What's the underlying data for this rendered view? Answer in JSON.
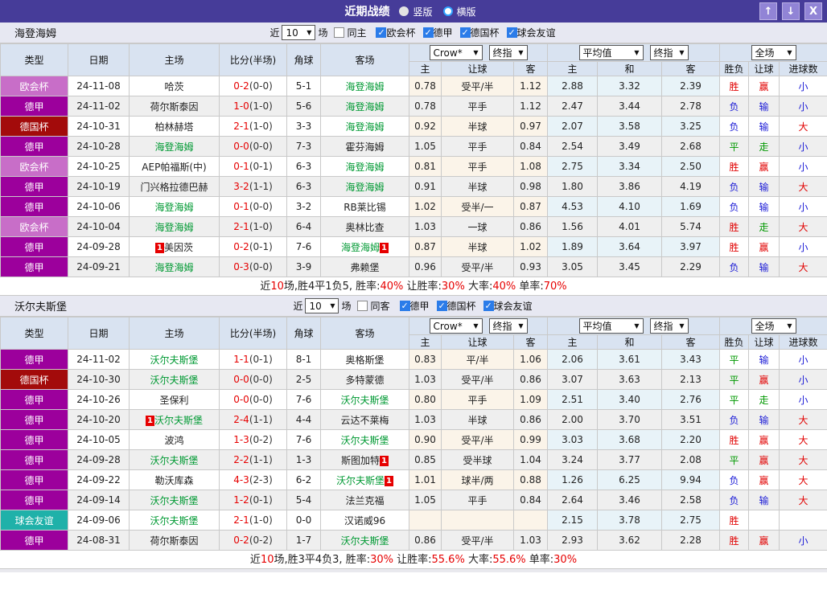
{
  "titlebar": {
    "title": "近期战绩",
    "radios": [
      {
        "label": "竖版",
        "selected": true
      },
      {
        "label": "横版",
        "selected": false
      }
    ]
  },
  "icons": {
    "up_arrow": "↑",
    "down_arrow": "↓",
    "close": "X",
    "chevron_down": "▼"
  },
  "filter_labels": {
    "near": "近",
    "games": "场"
  },
  "dropdowns": {
    "source": "Crow*",
    "final1": "终指",
    "avg": "平均值",
    "final2": "终指",
    "scope": "全场"
  },
  "columns": {
    "type": "类型",
    "date": "日期",
    "home": "主场",
    "score": "比分(半场)",
    "corner": "角球",
    "away": "客场",
    "sub_home": "主",
    "sub_handicap": "让球",
    "sub_away": "客",
    "sub_avg_home": "主",
    "sub_avg_draw": "和",
    "sub_avg_away": "客",
    "sub_result": "胜负",
    "sub_handicap_result": "让球",
    "sub_goals": "进球数"
  },
  "league_colors": {
    "欧会杯": "#c86ec8",
    "德甲": "#9c009c",
    "德国杯": "#a30b0b",
    "球会友谊": "#1fb1a9"
  },
  "value_colors": {
    "胜": "#e10000",
    "赢": "#e10000",
    "大": "#e10000",
    "负": "#1a1ad6",
    "输": "#1a1ad6",
    "小": "#1a1ad6",
    "平": "#009900",
    "走": "#009900"
  },
  "sections": [
    {
      "team": "海登海姆",
      "near_value": "10",
      "same_label": "同主",
      "same_checked": false,
      "leagues": [
        {
          "label": "欧会杯",
          "checked": true
        },
        {
          "label": "德甲",
          "checked": true
        },
        {
          "label": "德国杯",
          "checked": true
        },
        {
          "label": "球会友谊",
          "checked": true
        }
      ],
      "rows": [
        {
          "type": "欧会杯",
          "date": "24-11-08",
          "home": "哈茨",
          "home_is_subject": false,
          "home_badge": "",
          "score_full": "0-2",
          "score_half": "(0-0)",
          "corner": "5-1",
          "away": "海登海姆",
          "away_is_subject": true,
          "away_badge": "",
          "odds_home": "0.78",
          "handicap": "受平/半",
          "odds_away": "1.12",
          "avg_home": "2.88",
          "avg_draw": "3.32",
          "avg_away": "2.39",
          "result": "胜",
          "handicap_result": "赢",
          "goals": "小"
        },
        {
          "type": "德甲",
          "date": "24-11-02",
          "home": "荷尔斯泰因",
          "home_is_subject": false,
          "home_badge": "",
          "score_full": "1-0",
          "score_half": "(1-0)",
          "corner": "5-6",
          "away": "海登海姆",
          "away_is_subject": true,
          "away_badge": "",
          "odds_home": "0.78",
          "handicap": "平手",
          "odds_away": "1.12",
          "avg_home": "2.47",
          "avg_draw": "3.44",
          "avg_away": "2.78",
          "result": "负",
          "handicap_result": "输",
          "goals": "小"
        },
        {
          "type": "德国杯",
          "date": "24-10-31",
          "home": "柏林赫塔",
          "home_is_subject": false,
          "home_badge": "",
          "score_full": "2-1",
          "score_half": "(1-0)",
          "corner": "3-3",
          "away": "海登海姆",
          "away_is_subject": true,
          "away_badge": "",
          "odds_home": "0.92",
          "handicap": "半球",
          "odds_away": "0.97",
          "avg_home": "2.07",
          "avg_draw": "3.58",
          "avg_away": "3.25",
          "result": "负",
          "handicap_result": "输",
          "goals": "大"
        },
        {
          "type": "德甲",
          "date": "24-10-28",
          "home": "海登海姆",
          "home_is_subject": true,
          "home_badge": "",
          "score_full": "0-0",
          "score_half": "(0-0)",
          "corner": "7-3",
          "away": "霍芬海姆",
          "away_is_subject": false,
          "away_badge": "",
          "odds_home": "1.05",
          "handicap": "平手",
          "odds_away": "0.84",
          "avg_home": "2.54",
          "avg_draw": "3.49",
          "avg_away": "2.68",
          "result": "平",
          "handicap_result": "走",
          "goals": "小"
        },
        {
          "type": "欧会杯",
          "date": "24-10-25",
          "home": "AEP帕福斯(中)",
          "home_is_subject": false,
          "home_badge": "",
          "score_full": "0-1",
          "score_half": "(0-1)",
          "corner": "6-3",
          "away": "海登海姆",
          "away_is_subject": true,
          "away_badge": "",
          "odds_home": "0.81",
          "handicap": "平手",
          "odds_away": "1.08",
          "avg_home": "2.75",
          "avg_draw": "3.34",
          "avg_away": "2.50",
          "result": "胜",
          "handicap_result": "赢",
          "goals": "小"
        },
        {
          "type": "德甲",
          "date": "24-10-19",
          "home": "门兴格拉德巴赫",
          "home_is_subject": false,
          "home_badge": "",
          "score_full": "3-2",
          "score_half": "(1-1)",
          "corner": "6-3",
          "away": "海登海姆",
          "away_is_subject": true,
          "away_badge": "",
          "odds_home": "0.91",
          "handicap": "半球",
          "odds_away": "0.98",
          "avg_home": "1.80",
          "avg_draw": "3.86",
          "avg_away": "4.19",
          "result": "负",
          "handicap_result": "输",
          "goals": "大"
        },
        {
          "type": "德甲",
          "date": "24-10-06",
          "home": "海登海姆",
          "home_is_subject": true,
          "home_badge": "",
          "score_full": "0-1",
          "score_half": "(0-0)",
          "corner": "3-2",
          "away": "RB莱比锡",
          "away_is_subject": false,
          "away_badge": "",
          "odds_home": "1.02",
          "handicap": "受半/一",
          "odds_away": "0.87",
          "avg_home": "4.53",
          "avg_draw": "4.10",
          "avg_away": "1.69",
          "result": "负",
          "handicap_result": "输",
          "goals": "小"
        },
        {
          "type": "欧会杯",
          "date": "24-10-04",
          "home": "海登海姆",
          "home_is_subject": true,
          "home_badge": "",
          "score_full": "2-1",
          "score_half": "(1-0)",
          "corner": "6-4",
          "away": "奥林比查",
          "away_is_subject": false,
          "away_badge": "",
          "odds_home": "1.03",
          "handicap": "一球",
          "odds_away": "0.86",
          "avg_home": "1.56",
          "avg_draw": "4.01",
          "avg_away": "5.74",
          "result": "胜",
          "handicap_result": "走",
          "goals": "大"
        },
        {
          "type": "德甲",
          "date": "24-09-28",
          "home": "美因茨",
          "home_is_subject": false,
          "home_badge": "1",
          "score_full": "0-2",
          "score_half": "(0-1)",
          "corner": "7-6",
          "away": "海登海姆",
          "away_is_subject": true,
          "away_badge": "1",
          "odds_home": "0.87",
          "handicap": "半球",
          "odds_away": "1.02",
          "avg_home": "1.89",
          "avg_draw": "3.64",
          "avg_away": "3.97",
          "result": "胜",
          "handicap_result": "赢",
          "goals": "小"
        },
        {
          "type": "德甲",
          "date": "24-09-21",
          "home": "海登海姆",
          "home_is_subject": true,
          "home_badge": "",
          "score_full": "0-3",
          "score_half": "(0-0)",
          "corner": "3-9",
          "away": "弗赖堡",
          "away_is_subject": false,
          "away_badge": "",
          "odds_home": "0.96",
          "handicap": "受平/半",
          "odds_away": "0.93",
          "avg_home": "3.05",
          "avg_draw": "3.45",
          "avg_away": "2.29",
          "result": "负",
          "handicap_result": "输",
          "goals": "大"
        }
      ],
      "summary": [
        {
          "t": "近",
          "red": false
        },
        {
          "t": "10",
          "red": true
        },
        {
          "t": "场,胜4平1负5, 胜率:",
          "red": false
        },
        {
          "t": "40%",
          "red": true
        },
        {
          "t": " 让胜率:",
          "red": false
        },
        {
          "t": "30%",
          "red": true
        },
        {
          "t": " 大率:",
          "red": false
        },
        {
          "t": "40%",
          "red": true
        },
        {
          "t": " 单率:",
          "red": false
        },
        {
          "t": "70%",
          "red": true
        }
      ]
    },
    {
      "team": "沃尔夫斯堡",
      "near_value": "10",
      "same_label": "同客",
      "same_checked": false,
      "leagues": [
        {
          "label": "德甲",
          "checked": true
        },
        {
          "label": "德国杯",
          "checked": true
        },
        {
          "label": "球会友谊",
          "checked": true
        }
      ],
      "rows": [
        {
          "type": "德甲",
          "date": "24-11-02",
          "home": "沃尔夫斯堡",
          "home_is_subject": true,
          "home_badge": "",
          "score_full": "1-1",
          "score_half": "(0-1)",
          "corner": "8-1",
          "away": "奥格斯堡",
          "away_is_subject": false,
          "away_badge": "",
          "odds_home": "0.83",
          "handicap": "平/半",
          "odds_away": "1.06",
          "avg_home": "2.06",
          "avg_draw": "3.61",
          "avg_away": "3.43",
          "result": "平",
          "handicap_result": "输",
          "goals": "小"
        },
        {
          "type": "德国杯",
          "date": "24-10-30",
          "home": "沃尔夫斯堡",
          "home_is_subject": true,
          "home_badge": "",
          "score_full": "0-0",
          "score_half": "(0-0)",
          "corner": "2-5",
          "away": "多特蒙德",
          "away_is_subject": false,
          "away_badge": "",
          "odds_home": "1.03",
          "handicap": "受平/半",
          "odds_away": "0.86",
          "avg_home": "3.07",
          "avg_draw": "3.63",
          "avg_away": "2.13",
          "result": "平",
          "handicap_result": "赢",
          "goals": "小"
        },
        {
          "type": "德甲",
          "date": "24-10-26",
          "home": "圣保利",
          "home_is_subject": false,
          "home_badge": "",
          "score_full": "0-0",
          "score_half": "(0-0)",
          "corner": "7-6",
          "away": "沃尔夫斯堡",
          "away_is_subject": true,
          "away_badge": "",
          "odds_home": "0.80",
          "handicap": "平手",
          "odds_away": "1.09",
          "avg_home": "2.51",
          "avg_draw": "3.40",
          "avg_away": "2.76",
          "result": "平",
          "handicap_result": "走",
          "goals": "小"
        },
        {
          "type": "德甲",
          "date": "24-10-20",
          "home": "沃尔夫斯堡",
          "home_is_subject": true,
          "home_badge": "1",
          "score_full": "2-4",
          "score_half": "(1-1)",
          "corner": "4-4",
          "away": "云达不莱梅",
          "away_is_subject": false,
          "away_badge": "",
          "odds_home": "1.03",
          "handicap": "半球",
          "odds_away": "0.86",
          "avg_home": "2.00",
          "avg_draw": "3.70",
          "avg_away": "3.51",
          "result": "负",
          "handicap_result": "输",
          "goals": "大"
        },
        {
          "type": "德甲",
          "date": "24-10-05",
          "home": "波鸿",
          "home_is_subject": false,
          "home_badge": "",
          "score_full": "1-3",
          "score_half": "(0-2)",
          "corner": "7-6",
          "away": "沃尔夫斯堡",
          "away_is_subject": true,
          "away_badge": "",
          "odds_home": "0.90",
          "handicap": "受平/半",
          "odds_away": "0.99",
          "avg_home": "3.03",
          "avg_draw": "3.68",
          "avg_away": "2.20",
          "result": "胜",
          "handicap_result": "赢",
          "goals": "大"
        },
        {
          "type": "德甲",
          "date": "24-09-28",
          "home": "沃尔夫斯堡",
          "home_is_subject": true,
          "home_badge": "",
          "score_full": "2-2",
          "score_half": "(1-1)",
          "corner": "1-3",
          "away": "斯图加特",
          "away_is_subject": false,
          "away_badge": "1",
          "odds_home": "0.85",
          "handicap": "受半球",
          "odds_away": "1.04",
          "avg_home": "3.24",
          "avg_draw": "3.77",
          "avg_away": "2.08",
          "result": "平",
          "handicap_result": "赢",
          "goals": "大"
        },
        {
          "type": "德甲",
          "date": "24-09-22",
          "home": "勒沃库森",
          "home_is_subject": false,
          "home_badge": "",
          "score_full": "4-3",
          "score_half": "(2-3)",
          "corner": "6-2",
          "away": "沃尔夫斯堡",
          "away_is_subject": true,
          "away_badge": "1",
          "odds_home": "1.01",
          "handicap": "球半/两",
          "odds_away": "0.88",
          "avg_home": "1.26",
          "avg_draw": "6.25",
          "avg_away": "9.94",
          "result": "负",
          "handicap_result": "赢",
          "goals": "大"
        },
        {
          "type": "德甲",
          "date": "24-09-14",
          "home": "沃尔夫斯堡",
          "home_is_subject": true,
          "home_badge": "",
          "score_full": "1-2",
          "score_half": "(0-1)",
          "corner": "5-4",
          "away": "法兰克福",
          "away_is_subject": false,
          "away_badge": "",
          "odds_home": "1.05",
          "handicap": "平手",
          "odds_away": "0.84",
          "avg_home": "2.64",
          "avg_draw": "3.46",
          "avg_away": "2.58",
          "result": "负",
          "handicap_result": "输",
          "goals": "大"
        },
        {
          "type": "球会友谊",
          "date": "24-09-06",
          "home": "沃尔夫斯堡",
          "home_is_subject": true,
          "home_badge": "",
          "score_full": "2-1",
          "score_half": "(1-0)",
          "corner": "0-0",
          "away": "汉诺威96",
          "away_is_subject": false,
          "away_badge": "",
          "odds_home": "",
          "handicap": "",
          "odds_away": "",
          "avg_home": "2.15",
          "avg_draw": "3.78",
          "avg_away": "2.75",
          "result": "胜",
          "handicap_result": "",
          "goals": ""
        },
        {
          "type": "德甲",
          "date": "24-08-31",
          "home": "荷尔斯泰因",
          "home_is_subject": false,
          "home_badge": "",
          "score_full": "0-2",
          "score_half": "(0-2)",
          "corner": "1-7",
          "away": "沃尔夫斯堡",
          "away_is_subject": true,
          "away_badge": "",
          "odds_home": "0.86",
          "handicap": "受平/半",
          "odds_away": "1.03",
          "avg_home": "2.93",
          "avg_draw": "3.62",
          "avg_away": "2.28",
          "result": "胜",
          "handicap_result": "赢",
          "goals": "小"
        }
      ],
      "summary": [
        {
          "t": "近",
          "red": false
        },
        {
          "t": "10",
          "red": true
        },
        {
          "t": "场,胜3平4负3, 胜率:",
          "red": false
        },
        {
          "t": "30%",
          "red": true
        },
        {
          "t": " 让胜率:",
          "red": false
        },
        {
          "t": "55.6%",
          "red": true
        },
        {
          "t": " 大率:",
          "red": false
        },
        {
          "t": "55.6%",
          "red": true
        },
        {
          "t": " 单率:",
          "red": false
        },
        {
          "t": "30%",
          "red": true
        }
      ]
    }
  ]
}
